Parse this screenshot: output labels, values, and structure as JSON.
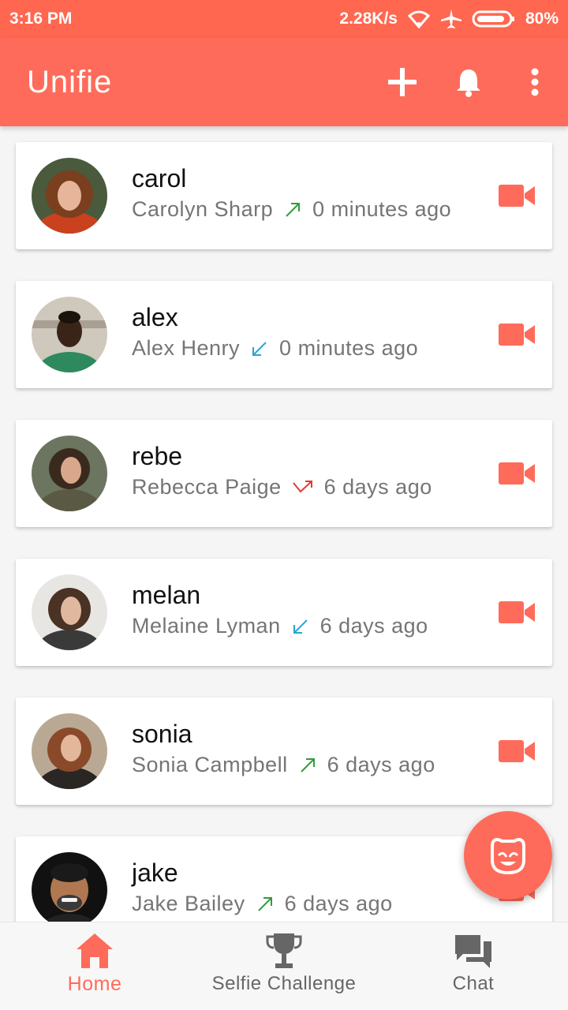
{
  "status_bar": {
    "time": "3:16 PM",
    "speed": "2.28K/s",
    "battery": "80%"
  },
  "app_bar": {
    "title": "Unifie",
    "icons": [
      "add-icon",
      "bell-icon",
      "more-vert-icon"
    ]
  },
  "colors": {
    "accent": "#ff6b5a",
    "status": "#ff6750",
    "outgoing": "#2e9e3a",
    "incoming": "#29a3d6",
    "missed": "#e53935"
  },
  "contacts": [
    {
      "username": "carol",
      "full_name": "Carolyn Sharp",
      "direction": "outgoing",
      "time": "0 minutes ago"
    },
    {
      "username": "alex",
      "full_name": "Alex Henry",
      "direction": "incoming",
      "time": "0 minutes ago"
    },
    {
      "username": "rebe",
      "full_name": "Rebecca Paige",
      "direction": "missed",
      "time": "6 days ago"
    },
    {
      "username": "melan",
      "full_name": "Melaine Lyman",
      "direction": "incoming",
      "time": "6 days ago"
    },
    {
      "username": "sonia",
      "full_name": "Sonia Campbell",
      "direction": "outgoing",
      "time": "6 days ago"
    },
    {
      "username": "jake",
      "full_name": "Jake Bailey",
      "direction": "outgoing",
      "time": "6 days ago"
    }
  ],
  "bottom_nav": [
    {
      "label": "Home",
      "icon": "home-icon",
      "active": true
    },
    {
      "label": "Selfie Challenge",
      "icon": "trophy-icon",
      "active": false
    },
    {
      "label": "Chat",
      "icon": "chat-icon",
      "active": false
    }
  ],
  "fab": {
    "icon": "selfie-face-icon"
  }
}
